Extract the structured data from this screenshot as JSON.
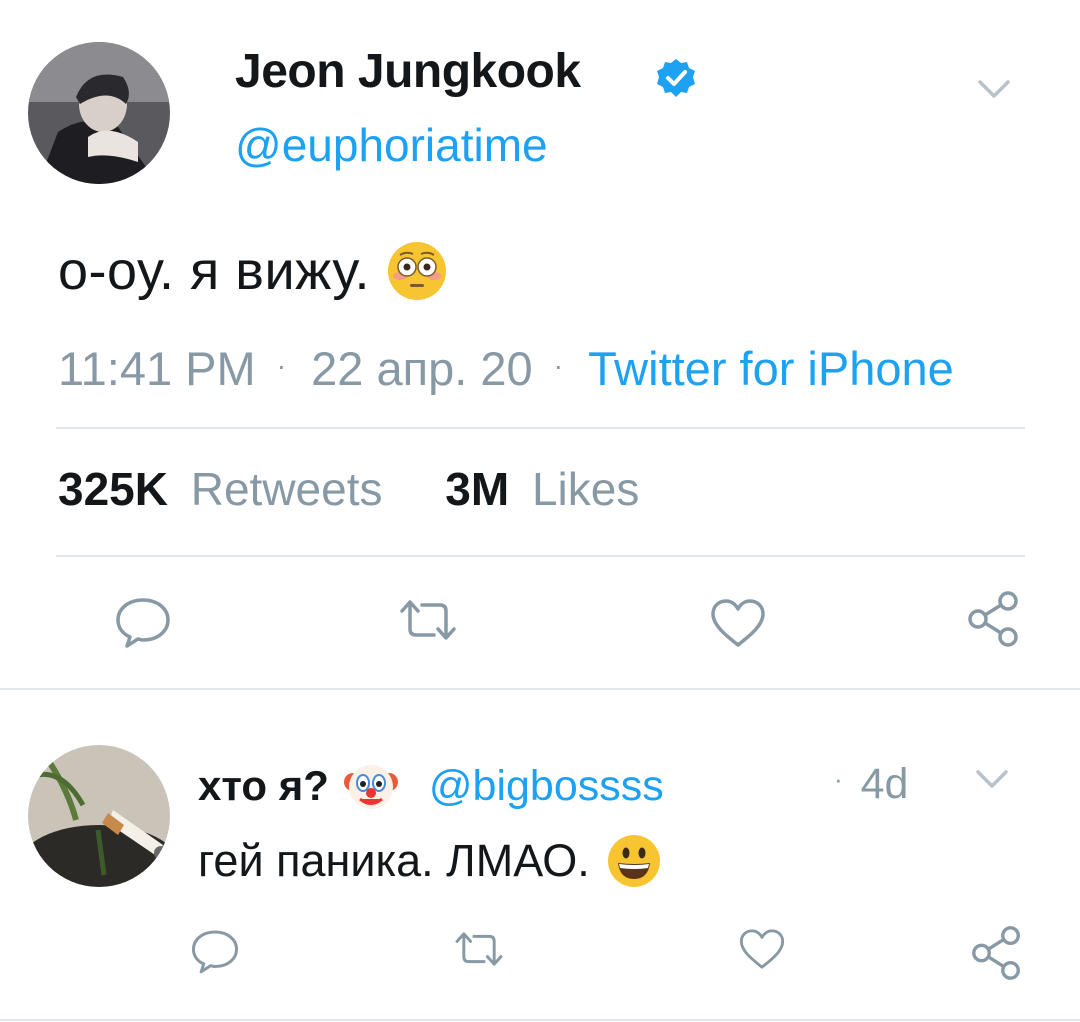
{
  "tweet": {
    "author_name": "Jeon Jungkook",
    "author_handle": "@euphoriatime",
    "text": "о-оу. я вижу.",
    "text_emoji": "flushed-face",
    "time": "11:41 PM",
    "separator": "·",
    "date": "22 апр. 20",
    "source": "Twitter for iPhone",
    "retweets_count": "325K",
    "retweets_label": "Retweets",
    "likes_count": "3M",
    "likes_label": "Likes"
  },
  "reply": {
    "author_name": "хто я?",
    "author_emoji": "clown-face",
    "author_handle": "@bigbossss",
    "separator": "·",
    "age": "4d",
    "text": "гей паника. ЛМАО.",
    "text_emoji": "grinning-face"
  },
  "colors": {
    "accent": "#1da1f2",
    "muted": "#8899a6",
    "text": "#14171a",
    "divider": "#e1e8ed",
    "verified": "#1da1f2",
    "emoji_yellow": "#f7c531"
  }
}
